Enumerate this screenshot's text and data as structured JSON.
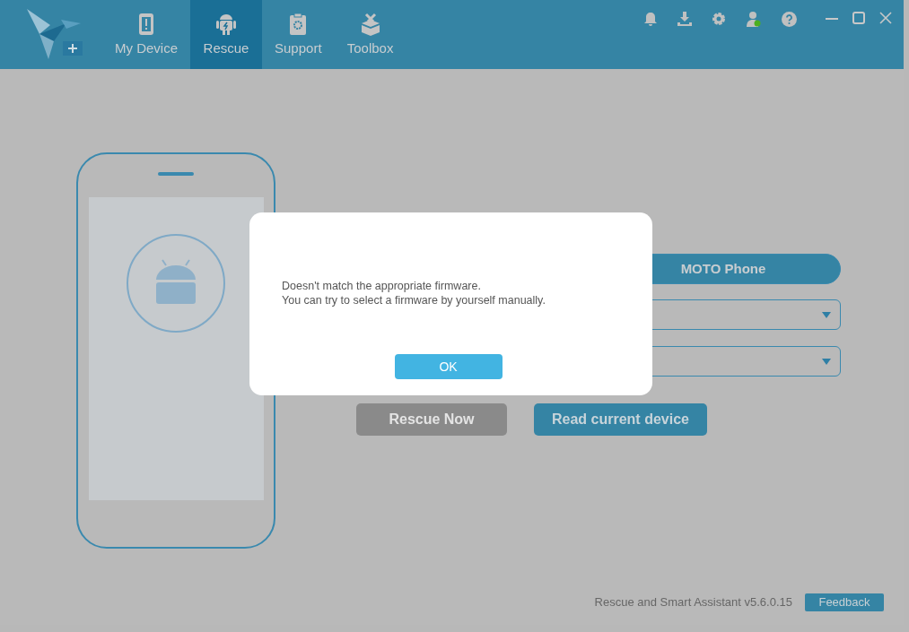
{
  "tabs": [
    {
      "label": "My Device",
      "kind": "device",
      "selected": false
    },
    {
      "label": "Rescue",
      "kind": "rescue",
      "selected": true
    },
    {
      "label": "Support",
      "kind": "support",
      "selected": false
    },
    {
      "label": "Toolbox",
      "kind": "toolbox",
      "selected": false
    }
  ],
  "device_types": [
    {
      "label": "MOTO Phone",
      "selected": true
    }
  ],
  "actions": [
    {
      "label": "Rescue Now",
      "disabled": true
    },
    {
      "label": "Read current device",
      "disabled": false
    }
  ],
  "dialog": {
    "message": [
      "Doesn't match the appropriate firmware.",
      "You can try to select a firmware by yourself manually."
    ],
    "button": "OK"
  },
  "footer": {
    "version": "Rescue and Smart Assistant v5.6.0.15",
    "feedback": "Feedback"
  }
}
